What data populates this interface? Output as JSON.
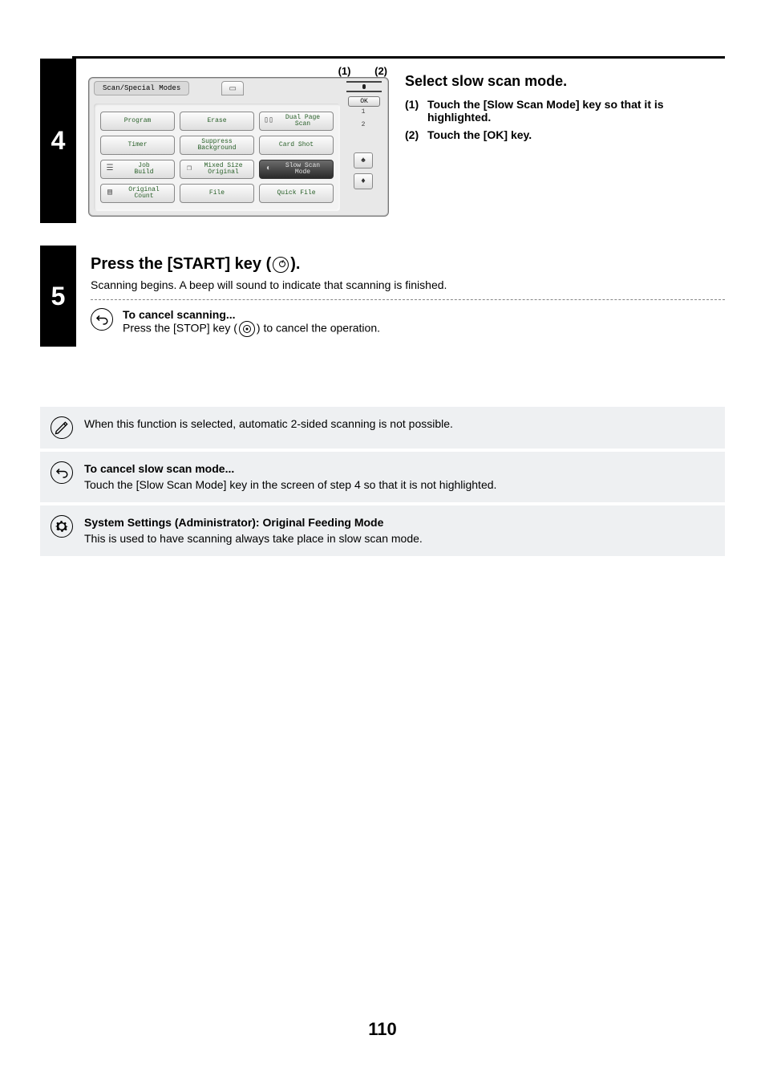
{
  "page_number": "110",
  "step4": {
    "callouts": {
      "c1": "(1)",
      "c2": "(2)"
    },
    "panel": {
      "title": "Scan/Special Modes",
      "ok": "OK",
      "side_numbers": [
        "1",
        "2"
      ],
      "buttons": [
        {
          "label": "Program"
        },
        {
          "label": "Erase"
        },
        {
          "label": "Dual Page\nScan",
          "icon": "book"
        },
        {
          "label": "Timer"
        },
        {
          "label": "Suppress\nBackground"
        },
        {
          "label": "Card Shot"
        },
        {
          "label": "Job\nBuild",
          "icon": "stack"
        },
        {
          "label": "Mixed Size\nOriginal",
          "icon": "pages"
        },
        {
          "label": "Slow Scan\nMode",
          "icon": "snail",
          "highlight": true
        },
        {
          "label": "Original\nCount",
          "icon": "doc"
        },
        {
          "label": "File"
        },
        {
          "label": "Quick File"
        }
      ]
    },
    "heading": "Select slow scan mode.",
    "items": [
      {
        "n": "(1)",
        "t": "Touch the [Slow Scan Mode] key so that it is highlighted."
      },
      {
        "n": "(2)",
        "t": "Touch the [OK] key."
      }
    ]
  },
  "step5": {
    "title_pre": "Press the [START] key (",
    "title_post": ").",
    "desc": "Scanning begins. A beep will sound to indicate that scanning is finished.",
    "cancel_title": "To cancel scanning...",
    "cancel_body_pre": "Press the [STOP] key (",
    "cancel_body_post": ") to cancel the operation."
  },
  "notes": {
    "n1": "When this function is selected, automatic 2-sided scanning is not possible.",
    "n2_title": "To cancel slow scan mode...",
    "n2_body": "Touch the [Slow Scan Mode] key in the screen of step 4 so that it is not highlighted.",
    "n3_title": "System Settings (Administrator): Original Feeding Mode",
    "n3_body": "This is used to have scanning always take place in slow scan mode."
  },
  "step_numbers": {
    "s4": "4",
    "s5": "5"
  }
}
